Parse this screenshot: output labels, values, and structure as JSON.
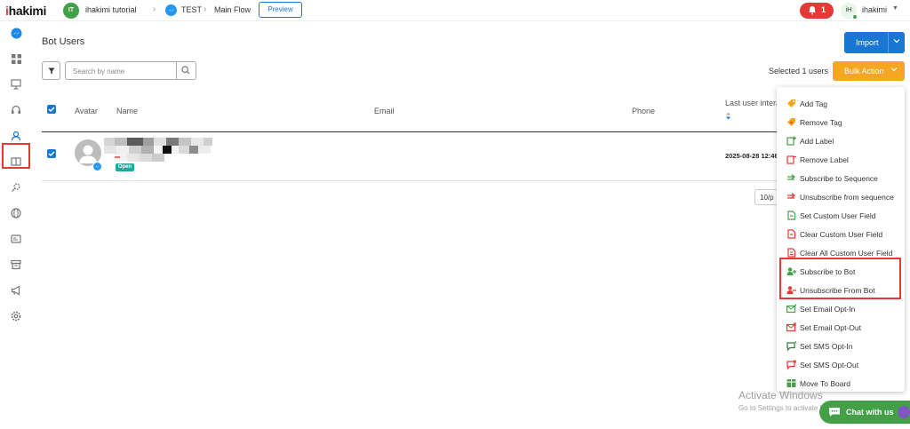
{
  "app": {
    "logo_prefix": "i",
    "logo_name": "hakimi"
  },
  "breadcrumb": {
    "workspace_initials": "IT",
    "workspace_name": "ihakimi tutorial",
    "bot_name": "TEST",
    "flow_name": "Main Flow",
    "preview_label": "Preview"
  },
  "topbar": {
    "notification_count": "1",
    "user_initials": "iH",
    "user_name": "ihakimi"
  },
  "sidebar": {
    "items": [
      {
        "icon": "messenger-icon",
        "active": false
      },
      {
        "icon": "dashboard-icon",
        "active": false
      },
      {
        "icon": "presentation-icon",
        "active": false
      },
      {
        "icon": "headset-icon",
        "active": false
      },
      {
        "icon": "user-icon",
        "active": true
      },
      {
        "icon": "book-icon",
        "active": false
      },
      {
        "icon": "search-settings-icon",
        "active": false
      },
      {
        "icon": "globe-icon",
        "active": false
      },
      {
        "icon": "id-card-icon",
        "active": false
      },
      {
        "icon": "archive-icon",
        "active": false
      },
      {
        "icon": "megaphone-icon",
        "active": false
      },
      {
        "icon": "settings-icon",
        "active": false
      }
    ]
  },
  "page": {
    "title": "Bot Users",
    "search_placeholder": "Search by name",
    "import_label": "Import",
    "selected_text": "Selected 1 users",
    "bulk_action_label": "Bulk Action"
  },
  "table": {
    "columns": [
      "Avatar",
      "Name",
      "Email",
      "Phone",
      "Last user intera"
    ],
    "rows": [
      {
        "status": "Open",
        "last_interaction": "2025-08-28 12:46"
      }
    ]
  },
  "pagination": {
    "page_size": "10/p"
  },
  "bulk_menu": {
    "items": [
      {
        "label": "Add Tag",
        "icon": "tag-add-icon",
        "color": "#f5a623"
      },
      {
        "label": "Remove Tag",
        "icon": "tag-remove-icon",
        "color": "#f5a623"
      },
      {
        "label": "Add Label",
        "icon": "label-add-icon",
        "color": "#43a047"
      },
      {
        "label": "Remove Label",
        "icon": "label-remove-icon",
        "color": "#e53935"
      },
      {
        "label": "Subscribe to Sequence",
        "icon": "sequence-subscribe-icon",
        "color": "#43a047"
      },
      {
        "label": "Unsubscribe from sequence",
        "icon": "sequence-unsubscribe-icon",
        "color": "#e53935"
      },
      {
        "label": "Set Custom User Field",
        "icon": "field-set-icon",
        "color": "#43a047"
      },
      {
        "label": "Clear Custom User Field",
        "icon": "field-clear-icon",
        "color": "#e53935"
      },
      {
        "label": "Clear All Custom User Field",
        "icon": "field-clear-all-icon",
        "color": "#e53935"
      },
      {
        "label": "Subscribe to Bot",
        "icon": "user-add-icon",
        "color": "#43a047"
      },
      {
        "label": "Unsubscribe From Bot",
        "icon": "user-remove-icon",
        "color": "#e53935"
      },
      {
        "label": "Set Email Opt-In",
        "icon": "email-optin-icon",
        "color": "#43a047"
      },
      {
        "label": "Set Email Opt-Out",
        "icon": "email-optout-icon",
        "color": "#e53935"
      },
      {
        "label": "Set SMS Opt-In",
        "icon": "sms-optin-icon",
        "color": "#43a047"
      },
      {
        "label": "Set SMS Opt-Out",
        "icon": "sms-optout-icon",
        "color": "#e53935"
      },
      {
        "label": "Move To Board",
        "icon": "board-icon",
        "color": "#43a047"
      }
    ]
  },
  "watermark": {
    "title": "Activate Windows",
    "subtitle": "Go to Settings to activate Windows."
  },
  "chat": {
    "label": "Chat with us"
  },
  "colors": {
    "primary": "#1976d2",
    "bulk": "#f5a623",
    "danger": "#e53935",
    "success": "#43a047"
  }
}
